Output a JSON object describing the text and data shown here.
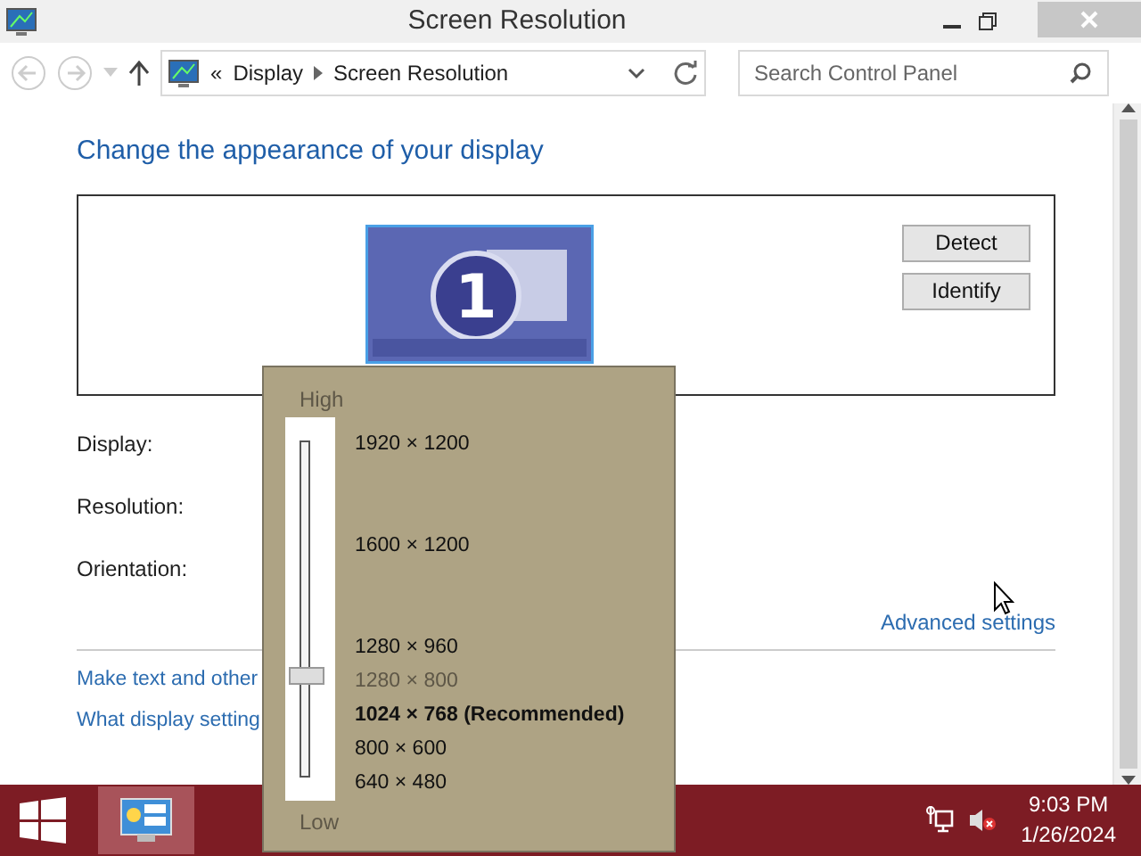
{
  "window": {
    "title": "Screen Resolution"
  },
  "address_bar": {
    "overflow": "«",
    "crumbs": [
      "Display",
      "Screen Resolution"
    ]
  },
  "search": {
    "placeholder": "Search Control Panel"
  },
  "heading": "Change the appearance of your display",
  "monitor": {
    "number": "1"
  },
  "buttons": [
    "Detect",
    "Identify"
  ],
  "fields": [
    "Display:",
    "Resolution:",
    "Orientation:"
  ],
  "advanced_link": "Advanced settings",
  "links": [
    "Make text and other",
    "What display setting"
  ],
  "resolution_popup": {
    "high_label": "High",
    "low_label": "Low",
    "level": 0.3,
    "options": [
      {
        "label": "1920 × 1200",
        "selected": false,
        "recommended": false
      },
      {
        "label": "1600 × 1200",
        "selected": false,
        "recommended": false
      },
      {
        "label": "1280 × 960",
        "selected": false,
        "recommended": false
      },
      {
        "label": "1280 × 800",
        "selected": true,
        "recommended": false
      },
      {
        "label": "1024 × 768 (Recommended)",
        "selected": false,
        "recommended": true
      },
      {
        "label": "800 × 600",
        "selected": false,
        "recommended": false
      },
      {
        "label": "640 × 480",
        "selected": false,
        "recommended": false
      }
    ]
  },
  "taskbar": {
    "time": "9:03 PM",
    "date": "1/26/2024"
  }
}
